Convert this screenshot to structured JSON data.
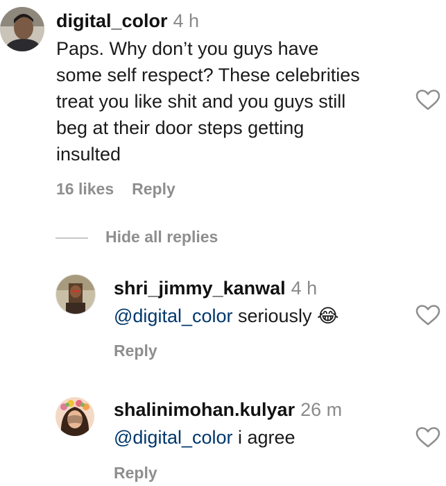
{
  "main_comment": {
    "username": "digital_color",
    "time": "4 h",
    "lines": [
      "Paps. Why don’t you guys have",
      "some self respect? These celebrities",
      "treat you like shit and you guys still",
      "beg at their door steps getting",
      "insulted"
    ],
    "likes": "16 likes",
    "reply_label": "Reply"
  },
  "replies_toggle": "Hide all replies",
  "replies": [
    {
      "username": "shri_jimmy_kanwal",
      "time": "4 h",
      "mention": "@digital_color",
      "text": " seriously 😂",
      "reply_label": "Reply"
    },
    {
      "username": "shalinimohan.kulyar",
      "time": "26 m",
      "mention": "@digital_color",
      "text": " i agree",
      "reply_label": "Reply"
    }
  ],
  "colors": {
    "mention": "#00376b",
    "secondary": "#8e8e8e",
    "heart_outline": "#8e8e8e"
  },
  "icons": [
    "heart-outline-icon"
  ]
}
